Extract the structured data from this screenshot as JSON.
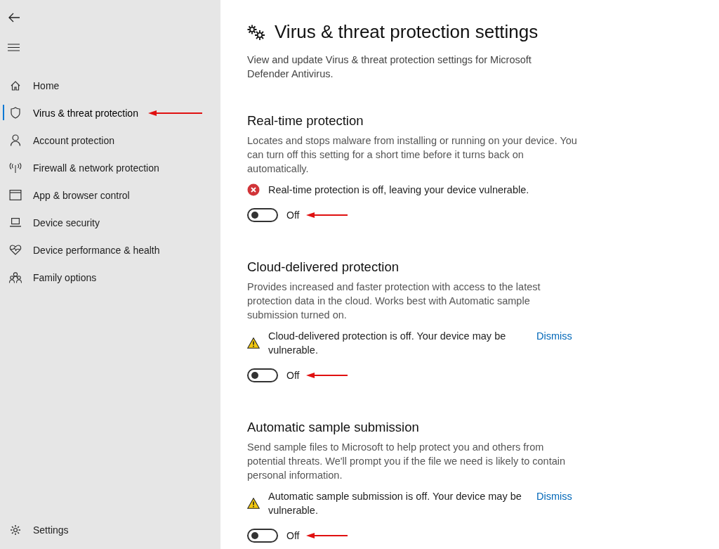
{
  "sidebar": {
    "items": [
      {
        "label": "Home",
        "kind": "home",
        "selected": false,
        "annotated": false
      },
      {
        "label": "Virus & threat protection",
        "kind": "shield",
        "selected": true,
        "annotated": true
      },
      {
        "label": "Account protection",
        "kind": "person",
        "selected": false,
        "annotated": false
      },
      {
        "label": "Firewall & network protection",
        "kind": "antenna",
        "selected": false,
        "annotated": false
      },
      {
        "label": "App & browser control",
        "kind": "window",
        "selected": false,
        "annotated": false
      },
      {
        "label": "Device security",
        "kind": "laptop",
        "selected": false,
        "annotated": false
      },
      {
        "label": "Device performance & health",
        "kind": "heart",
        "selected": false,
        "annotated": false
      },
      {
        "label": "Family options",
        "kind": "family",
        "selected": false,
        "annotated": false
      }
    ],
    "settings": {
      "label": "Settings"
    }
  },
  "page": {
    "title": "Virus & threat protection settings",
    "description": "View and update Virus & threat protection settings for Microsoft Defender Antivirus."
  },
  "sections": [
    {
      "heading": "Real-time protection",
      "description": "Locates and stops malware from installing or running on your device. You can turn off this setting for a short time before it turns back on automatically.",
      "alert": {
        "kind": "error",
        "text": "Real-time protection is off, leaving your device vulnerable."
      },
      "toggle": {
        "on": false,
        "label": "Off",
        "annotated": true
      }
    },
    {
      "heading": "Cloud-delivered protection",
      "description": "Provides increased and faster protection with access to the latest protection data in the cloud. Works best with Automatic sample submission turned on.",
      "alert": {
        "kind": "warning",
        "text": "Cloud-delivered protection is off. Your device may be vulnerable.",
        "link": "Dismiss"
      },
      "toggle": {
        "on": false,
        "label": "Off",
        "annotated": true
      }
    },
    {
      "heading": "Automatic sample submission",
      "description": "Send sample files to Microsoft to help protect you and others from potential threats. We'll prompt you if the file we need is likely to contain personal information.",
      "alert": {
        "kind": "warning",
        "text": "Automatic sample submission is off. Your device may be vulnerable.",
        "link": "Dismiss"
      },
      "toggle": {
        "on": false,
        "label": "Off",
        "annotated": true
      }
    }
  ]
}
